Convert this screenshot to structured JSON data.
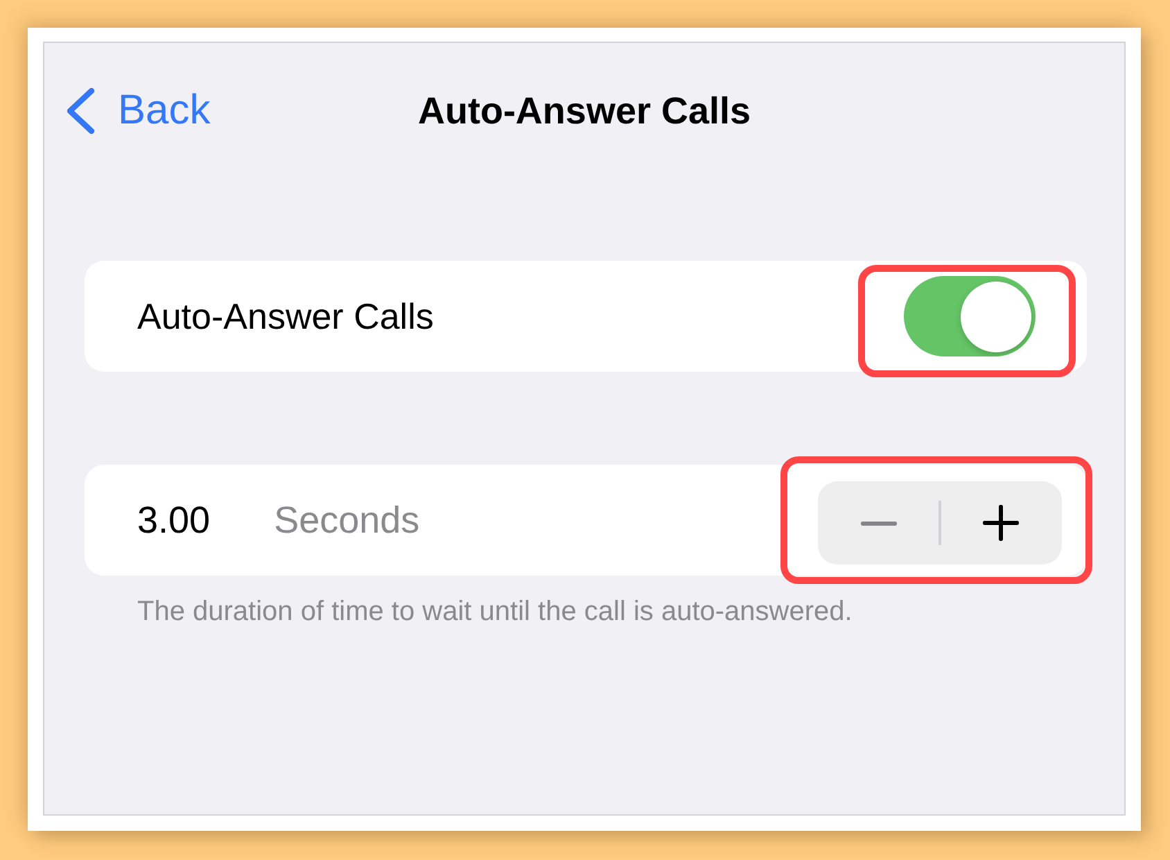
{
  "nav": {
    "back_label": "Back",
    "title": "Auto-Answer Calls"
  },
  "rows": [
    {
      "kind": "toggle",
      "label": "Auto-Answer Calls",
      "on": true,
      "highlighted": true
    },
    {
      "kind": "stepper",
      "value": "3.00",
      "unit": "Seconds",
      "buttons": [
        {
          "kind": "minus",
          "disabled": true
        },
        {
          "kind": "plus",
          "disabled": false
        }
      ],
      "highlighted": true
    }
  ],
  "footer": "The duration of time to wait until the call is auto-answered."
}
